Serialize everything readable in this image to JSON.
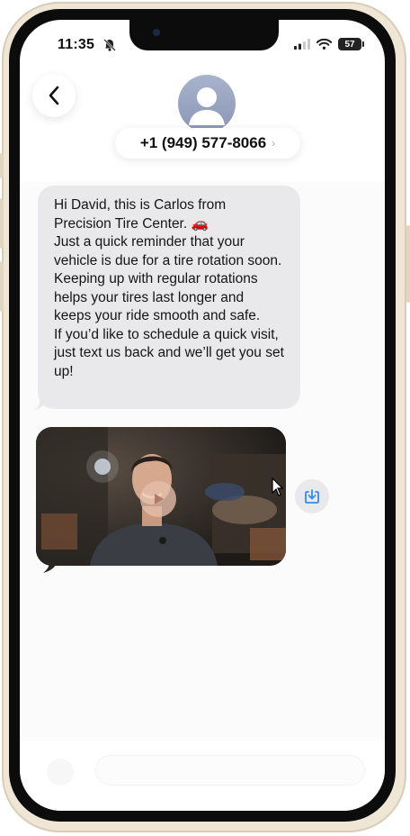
{
  "status_bar": {
    "time": "11:35",
    "battery": "57",
    "icons": [
      "bell-slash-icon",
      "cellular-signal-icon",
      "wifi-icon",
      "battery-icon"
    ]
  },
  "header": {
    "back_icon": "chevron-left-icon",
    "avatar_icon": "person-silhouette-icon",
    "contact_number": "+1 (949) 577-8066",
    "contact_chevron": "›"
  },
  "messages": [
    {
      "type": "text",
      "direction": "incoming",
      "text": "Hi David, this is Carlos from Precision Tire Center. 🚗\nJust a quick reminder that your vehicle is due for a tire rotation soon. Keeping up with regular rotations helps your tires last longer and keeps your ride smooth and safe.\nIf you’d like to schedule a quick visit, just text us back and we’ll get you set up!"
    },
    {
      "type": "video",
      "direction": "incoming",
      "play_icon": "play-icon",
      "action_icon": "download-icon"
    }
  ],
  "colors": {
    "incoming_bubble": "#e9e9eb",
    "download_accent": "#2f8cf0",
    "avatar": "#8a96b6",
    "frame": "#efe6d6"
  }
}
